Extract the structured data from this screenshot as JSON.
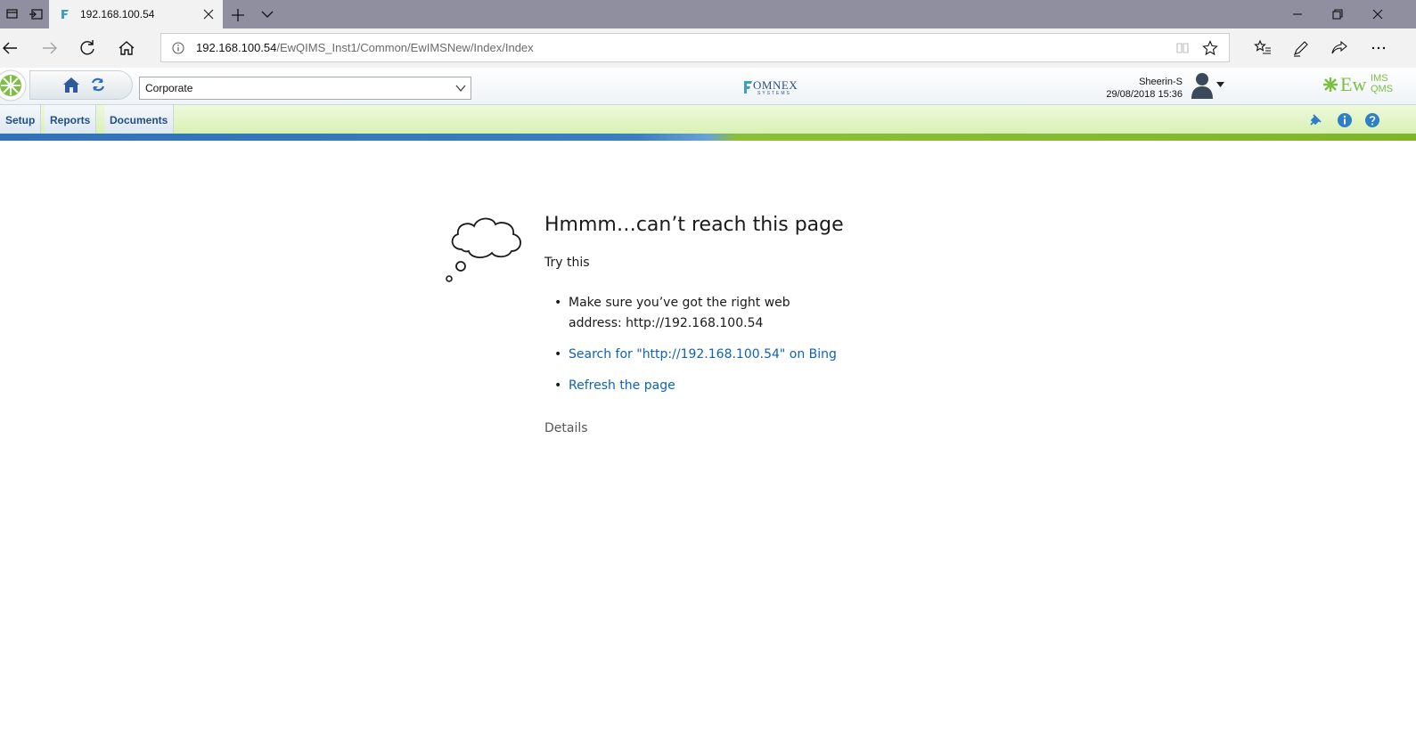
{
  "browser": {
    "tab": {
      "title": "192.168.100.54"
    },
    "address": {
      "host": "192.168.100.54",
      "path": "/EwQIMS_Inst1/Common/EwIMSNew/Index/Index"
    }
  },
  "app": {
    "org_selector": {
      "value": "Corporate"
    },
    "brand": {
      "omnex": "OMNEX",
      "omnex_sub": "SYSTEMS",
      "ew_main": "Ew",
      "ew_top": "IMS",
      "ew_bottom": "QMS"
    },
    "user": {
      "name": "Sheerin-S",
      "datetime": "29/08/2018 15:36"
    },
    "menu": [
      {
        "label": "Setup"
      },
      {
        "label": "Reports"
      },
      {
        "label": "Documents"
      }
    ],
    "colors": {
      "menu_text": "#1f4e8c",
      "menu_bar": "#d7f0b2",
      "accent_blue": "#2f72b6",
      "accent_green": "#7fb52c"
    }
  },
  "error_page": {
    "title": "Hmmm…can’t reach this page",
    "subtitle": "Try this",
    "suggestions": [
      {
        "text": "Make sure you’ve got the right web address: http://192.168.100.54"
      },
      {
        "text": "Search for \"http://192.168.100.54\" on Bing"
      },
      {
        "text": "Refresh the page"
      }
    ],
    "details_label": "Details",
    "link_color": "#0f62b4"
  }
}
